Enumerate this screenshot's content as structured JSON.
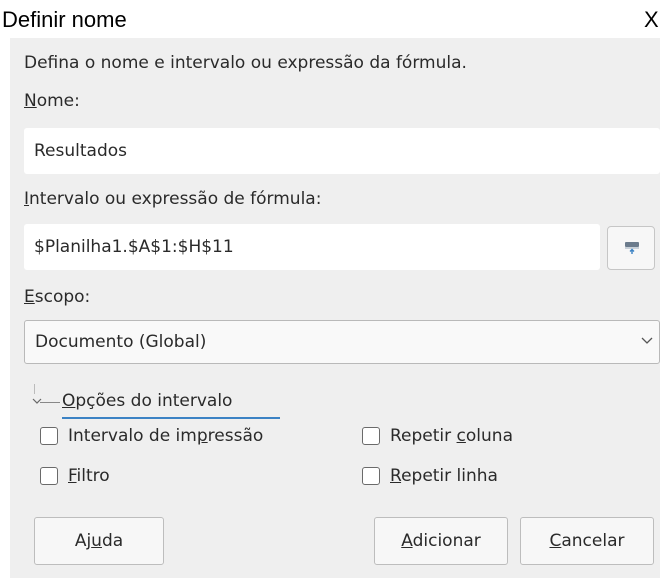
{
  "window": {
    "title": "Definir nome",
    "close_label": "X"
  },
  "dialog": {
    "description": "Defina o nome e intervalo ou expressão da fórmula.",
    "name_label": {
      "accel": "N",
      "rest": "ome:"
    },
    "name_value": "Resultados",
    "range_label": {
      "accel": "I",
      "rest": "ntervalo ou expressão de fórmula:"
    },
    "range_value": "$Planilha1.$A$1:$H$11",
    "shrink_icon": "shrink-range-icon",
    "scope_label": {
      "accel": "E",
      "rest": "scopo:"
    },
    "scope_value": "Documento (Global)",
    "range_options": {
      "expander_label": {
        "accel": "O",
        "rest": "pções do intervalo"
      },
      "print_range": {
        "pre": "Intervalo de im",
        "accel": "p",
        "post": "ressão",
        "checked": false
      },
      "filter": {
        "pre": "",
        "accel": "F",
        "post": "iltro",
        "checked": false
      },
      "repeat_column": {
        "pre": "Repetir ",
        "accel": "c",
        "post": "oluna",
        "checked": false
      },
      "repeat_row": {
        "pre": "",
        "accel": "R",
        "post": "epetir linha",
        "checked": false
      }
    },
    "buttons": {
      "help": {
        "pre": "Aj",
        "accel": "u",
        "post": "da"
      },
      "add": {
        "pre": "",
        "accel": "A",
        "post": "dicionar"
      },
      "cancel": {
        "pre": "",
        "accel": "C",
        "post": "ancelar"
      }
    }
  },
  "colors": {
    "dialog_bg": "#efefef",
    "field_bg": "#ffffff",
    "accent": "#3b82c4"
  }
}
